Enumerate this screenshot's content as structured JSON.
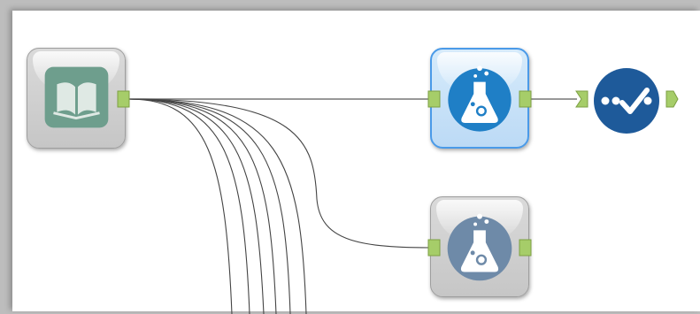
{
  "workflow": {
    "tools": [
      {
        "icon": "input-book-icon",
        "color": "#6a9a8a",
        "selected": false
      },
      {
        "icon": "lab-flask-icon",
        "color": "#1f7fc6",
        "selected": true
      },
      {
        "icon": "output-check-icon",
        "color": "#1e5a9a",
        "selected": false
      },
      {
        "icon": "lab-flask-icon",
        "color": "#6e8aa8",
        "selected": false
      }
    ],
    "anchor_color": "#a6cd69",
    "wire_color": "#333333"
  }
}
